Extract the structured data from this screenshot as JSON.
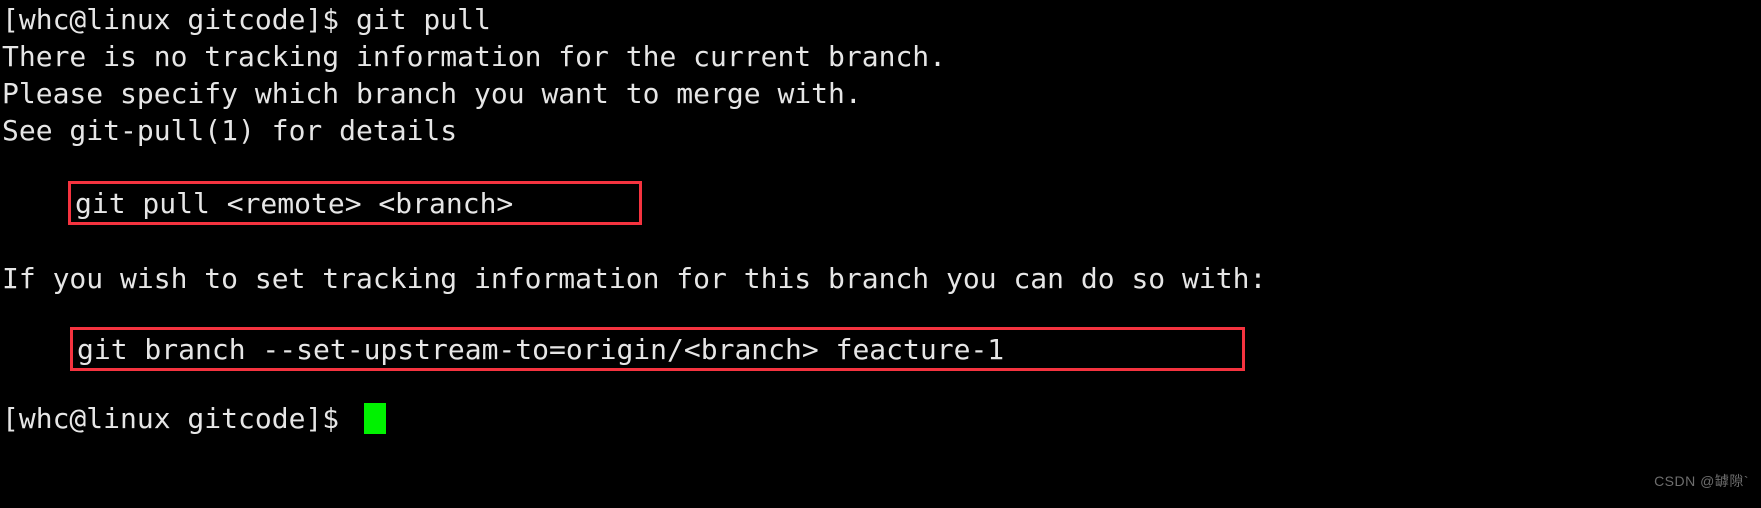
{
  "terminal": {
    "background_color": "#000000",
    "text_color": "#e6e6e6",
    "highlight_box_color": "#f5333f",
    "cursor_color": "#00f200",
    "lines": [
      "[whc@linux gitcode]$ git pull",
      "There is no tracking information for the current branch.",
      "Please specify which branch you want to merge with.",
      "See git-pull(1) for details",
      "If you wish to set tracking information for this branch you can do so with:"
    ],
    "boxed_commands": [
      "git pull <remote> <branch>",
      "git branch --set-upstream-to=origin/<branch> feacture-1"
    ],
    "final_prompt": "[whc@linux gitcode]$ ",
    "cursor": "block-cursor"
  },
  "watermark": {
    "text": "CSDN @罅隙`"
  }
}
